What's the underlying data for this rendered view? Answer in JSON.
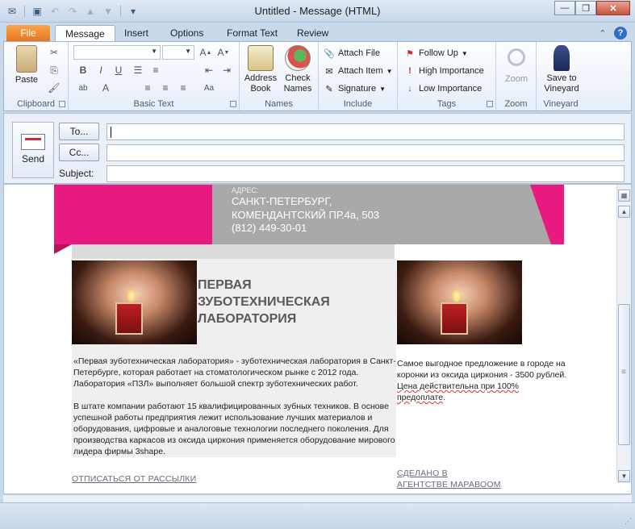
{
  "window": {
    "title": "Untitled  -  Message (HTML)",
    "qat_icons": [
      "outlook-icon",
      "save-icon",
      "undo-icon",
      "redo-icon",
      "arrow-up-icon",
      "arrow-down-icon",
      "customize-qat-icon"
    ]
  },
  "tabs": {
    "file": "File",
    "items": [
      "Message",
      "Insert",
      "Options",
      "Format Text",
      "Review"
    ],
    "active": "Message"
  },
  "ribbon": {
    "clipboard": {
      "label": "Clipboard",
      "paste": "Paste"
    },
    "basic_text": {
      "label": "Basic Text",
      "bold": "B",
      "italic": "I",
      "underline": "U",
      "font_color": "A"
    },
    "names": {
      "label": "Names",
      "address_book_1": "Address",
      "address_book_2": "Book",
      "check_names_1": "Check",
      "check_names_2": "Names"
    },
    "include": {
      "label": "Include",
      "attach_file": "Attach File",
      "attach_item": "Attach Item",
      "signature": "Signature"
    },
    "tags": {
      "label": "Tags",
      "follow_up": "Follow Up",
      "high_importance": "High Importance",
      "low_importance": "Low Importance"
    },
    "zoom": {
      "label": "Zoom",
      "button": "Zoom"
    },
    "vineyard": {
      "label": "Vineyard",
      "save_1": "Save to",
      "save_2": "Vineyard"
    }
  },
  "header": {
    "send": "Send",
    "to_button": "To...",
    "cc_button": "Cc...",
    "subject_label": "Subject:",
    "to_value": "",
    "cc_value": "",
    "subject_value": ""
  },
  "email": {
    "address_label": "АДРЕС:",
    "address_line1": "САНКТ-ПЕТЕРБУРГ,",
    "address_line2": "КОМЕНДАНТСКИЙ ПР.4а, 503",
    "phone": "(812) 449-30-01",
    "headline_1": "ПЕРВАЯ",
    "headline_2": "ЗУБОТЕХНИЧЕСКАЯ",
    "headline_3": "ЛАБОРАТОРИЯ",
    "para1": "«Первая зуботехническая лаборатория» - зуботехническая лаборатория в Санкт-Петербурге, которая работает на стоматологическом рынке с 2012 года. Лаборатория «ПЗЛ» выполняет большой спектр зуботехнических работ.",
    "para2": "В штате компании работают 15 квалифицированных зубных техников. В основе успешной работы предприятия лежит использование лучших материалов и оборудования, цифровые и аналоговые технологии последнего поколения. Для производства каркасов из оксида циркония применяется оборудование мирового лидера фирмы 3shape.",
    "offer_1": "Самое выгодное предложение в городе на коронки из оксида циркония - 3500 рублей. ",
    "offer_2": "Цена действительна при 100% предоплате",
    "offer_3": ".",
    "unsubscribe": "ОТПИСАТЬСЯ ОТ РАССЫЛКИ",
    "made_by_1": "СДЕЛАНО В",
    "made_by_2": "АГЕНТСТВЕ МАРАВООМ"
  },
  "colors": {
    "brand_pink": "#e8197f",
    "banner_gray": "#a9a9a9",
    "file_tab": "#e8741a"
  }
}
